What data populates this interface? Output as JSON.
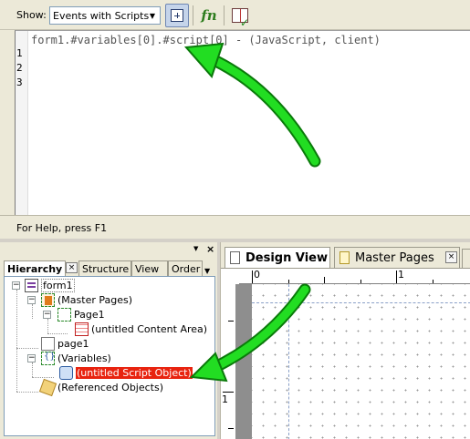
{
  "toolbar": {
    "show_label": "Show:",
    "event_select_value": "Events with Scripts",
    "insert_icon": "insert-script-object-icon",
    "fn_label": "fn",
    "check_icon": "check-script-syntax-icon"
  },
  "editor": {
    "header": "form1.#variables[0].#script[0] - (JavaScript, client)",
    "line_numbers": [
      "1",
      "2",
      "3"
    ]
  },
  "status_bar": {
    "text": "For Help, press F1"
  },
  "hierarchy": {
    "tabs": [
      "Hierarchy",
      "Structure",
      "View",
      "Order"
    ],
    "tree": [
      {
        "label": "form1",
        "icon": "form-icon"
      },
      {
        "label": "(Master Pages)",
        "icon": "master-pages-icon"
      },
      {
        "label": "Page1",
        "icon": "master-page-icon"
      },
      {
        "label": "(untitled Content Area)",
        "icon": "content-area-icon"
      },
      {
        "label": "page1",
        "icon": "page-icon"
      },
      {
        "label": "(Variables)",
        "icon": "variables-icon"
      },
      {
        "label": "(untitled Script Object)",
        "icon": "script-object-icon",
        "selected": true
      },
      {
        "label": "(Referenced Objects)",
        "icon": "referenced-objects-icon"
      }
    ]
  },
  "design": {
    "tabs": [
      "Design View",
      "Master Pages"
    ],
    "ruler_h_labels": [
      "0",
      "1"
    ],
    "ruler_v_label": "1"
  },
  "colors": {
    "arrow": "#22dd22",
    "selection": "#e8230f"
  }
}
